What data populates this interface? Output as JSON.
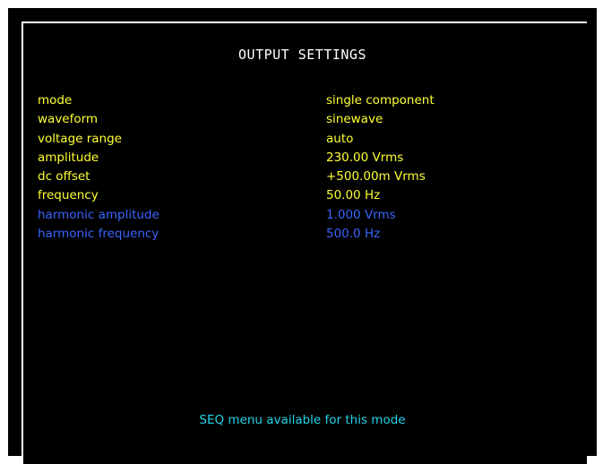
{
  "screen": {
    "title": "OUTPUT SETTINGS",
    "settings": [
      {
        "label": "mode",
        "value": "single component",
        "style": "primary"
      },
      {
        "label": "waveform",
        "value": "sinewave",
        "style": "primary"
      },
      {
        "label": "voltage range",
        "value": "auto",
        "style": "primary"
      },
      {
        "label": "amplitude",
        "value": "230.00 Vrms",
        "style": "primary"
      },
      {
        "label": "dc offset",
        "value": "+500.00m Vrms",
        "style": "primary"
      },
      {
        "label": "frequency",
        "value": "50.00 Hz",
        "style": "primary"
      },
      {
        "label": "harmonic amplitude",
        "value": "1.000 Vrms",
        "style": "secondary"
      },
      {
        "label": "harmonic frequency",
        "value": "500.0 Hz",
        "style": "secondary"
      }
    ],
    "footer": "SEQ menu available for this mode"
  },
  "colors": {
    "background": "#000000",
    "title": "#ffffff",
    "primary_text": "#ffff33",
    "secondary_text": "#3a64ff",
    "footer_text": "#22d4e8"
  }
}
